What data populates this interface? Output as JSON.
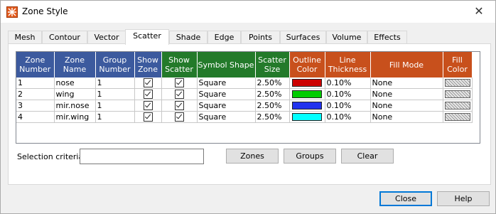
{
  "window": {
    "title": "Zone Style"
  },
  "tabs": [
    "Mesh",
    "Contour",
    "Vector",
    "Scatter",
    "Shade",
    "Edge",
    "Points",
    "Surfaces",
    "Volume",
    "Effects"
  ],
  "active_tab": "Scatter",
  "table": {
    "headers": [
      {
        "label": "Zone Number",
        "color": "blue"
      },
      {
        "label": "Zone Name",
        "color": "blue"
      },
      {
        "label": "Group Number",
        "color": "blue"
      },
      {
        "label": "Show Zone",
        "color": "blue"
      },
      {
        "label": "Show Scatter",
        "color": "green"
      },
      {
        "label": "Symbol Shape",
        "color": "green"
      },
      {
        "label": "Scatter Size",
        "color": "green"
      },
      {
        "label": "Outline Color",
        "color": "orange"
      },
      {
        "label": "Line Thickness",
        "color": "orange"
      },
      {
        "label": "Fill Mode",
        "color": "orange"
      },
      {
        "label": "Fill Color",
        "color": "orange"
      }
    ],
    "rows": [
      {
        "number": "1",
        "name": "nose",
        "group": "1",
        "show_zone": true,
        "show_scatter": true,
        "shape": "Square",
        "size": "2.50%",
        "outline_color": "#cc0000",
        "thickness": "0.10%",
        "fill_mode": "None",
        "fill_color": "hatched"
      },
      {
        "number": "2",
        "name": "wing",
        "group": "1",
        "show_zone": true,
        "show_scatter": true,
        "shape": "Square",
        "size": "2.50%",
        "outline_color": "#00cc00",
        "thickness": "0.10%",
        "fill_mode": "None",
        "fill_color": "hatched"
      },
      {
        "number": "3",
        "name": "mir.nose",
        "group": "1",
        "show_zone": true,
        "show_scatter": true,
        "shape": "Square",
        "size": "2.50%",
        "outline_color": "#2233ee",
        "thickness": "0.10%",
        "fill_mode": "None",
        "fill_color": "hatched"
      },
      {
        "number": "4",
        "name": "mir.wing",
        "group": "1",
        "show_zone": true,
        "show_scatter": true,
        "shape": "Square",
        "size": "2.50%",
        "outline_color": "#00ffff",
        "thickness": "0.10%",
        "fill_mode": "None",
        "fill_color": "hatched"
      }
    ]
  },
  "selection": {
    "label": "Selection criteria:",
    "value": ""
  },
  "buttons": {
    "zones": "Zones",
    "groups": "Groups",
    "clear": "Clear",
    "close": "Close",
    "help": "Help"
  },
  "colors": {
    "header_blue": "#3c5a9e",
    "header_green": "#237a2a",
    "header_orange": "#c8501c"
  }
}
